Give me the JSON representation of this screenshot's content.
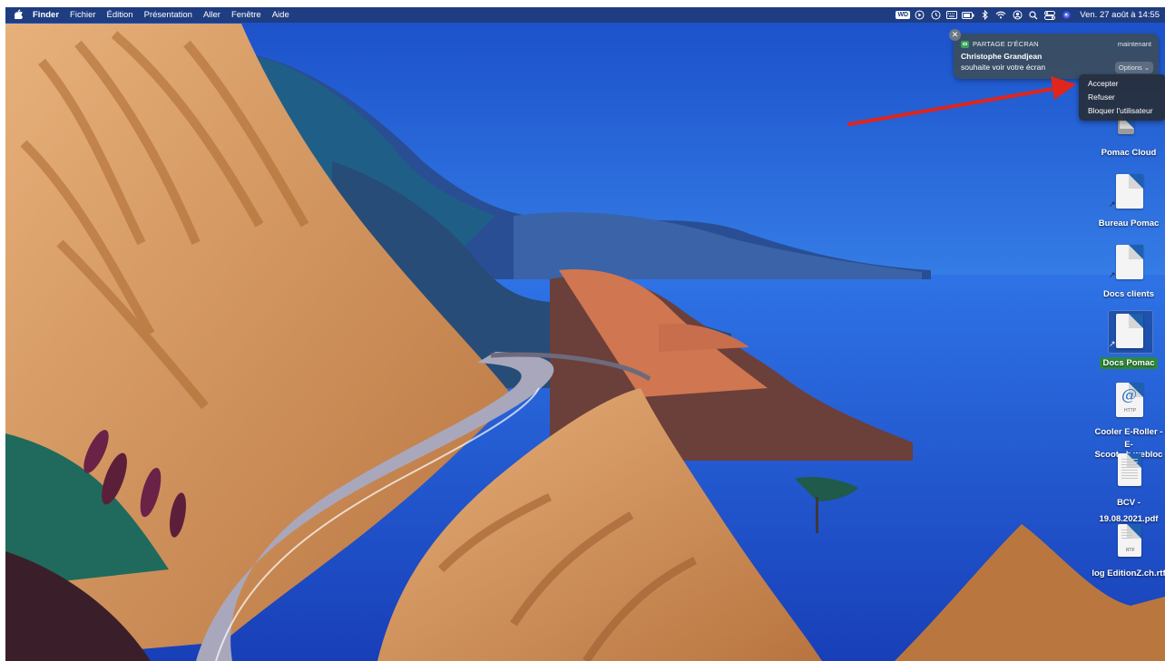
{
  "menubar": {
    "app_name": "Finder",
    "menus": [
      "Fichier",
      "Édition",
      "Présentation",
      "Aller",
      "Fenêtre",
      "Aide"
    ],
    "status_icons": [
      "wd-drive-icon",
      "play-circle-icon",
      "time-machine-icon",
      "keyboard-icon",
      "battery-icon",
      "bluetooth-icon",
      "wifi-icon",
      "user-circle-icon",
      "search-icon",
      "control-center-icon",
      "siri-icon"
    ],
    "wd_label": "WD",
    "clock": "Ven. 27 août à 14:55"
  },
  "notification": {
    "app_label": "PARTAGE D'ÉCRAN",
    "time": "maintenant",
    "title": "Christophe Grandjean",
    "body": "souhaite voir votre écran",
    "options_label": "Options ⌄",
    "close_label": "✕"
  },
  "dropdown": {
    "items": [
      "Accepter",
      "Refuser",
      "Bloquer l'utilisateur"
    ]
  },
  "desktop": {
    "icons": [
      {
        "label": "Pomac Cloud"
      },
      {
        "label": "Bureau Pomac"
      },
      {
        "label": "Docs clients"
      },
      {
        "label": "Docs Pomac"
      },
      {
        "label_line1": "Cooler E-Roller -",
        "label_line2": "E-Scoot...h.webloc",
        "badge": "HTTP"
      },
      {
        "label_line1": "BCV -",
        "label_line2": "19.08.2021.pdf"
      },
      {
        "label": "log EditionZ.ch.rtf",
        "badge": "RTF"
      }
    ]
  },
  "colors": {
    "sky": "#2c6de0",
    "sea": "#1f58d6",
    "cliff": "#d79a5e",
    "road": "#a8a6bb",
    "selection": "#2e8a3a",
    "arrow": "#e0251c"
  }
}
